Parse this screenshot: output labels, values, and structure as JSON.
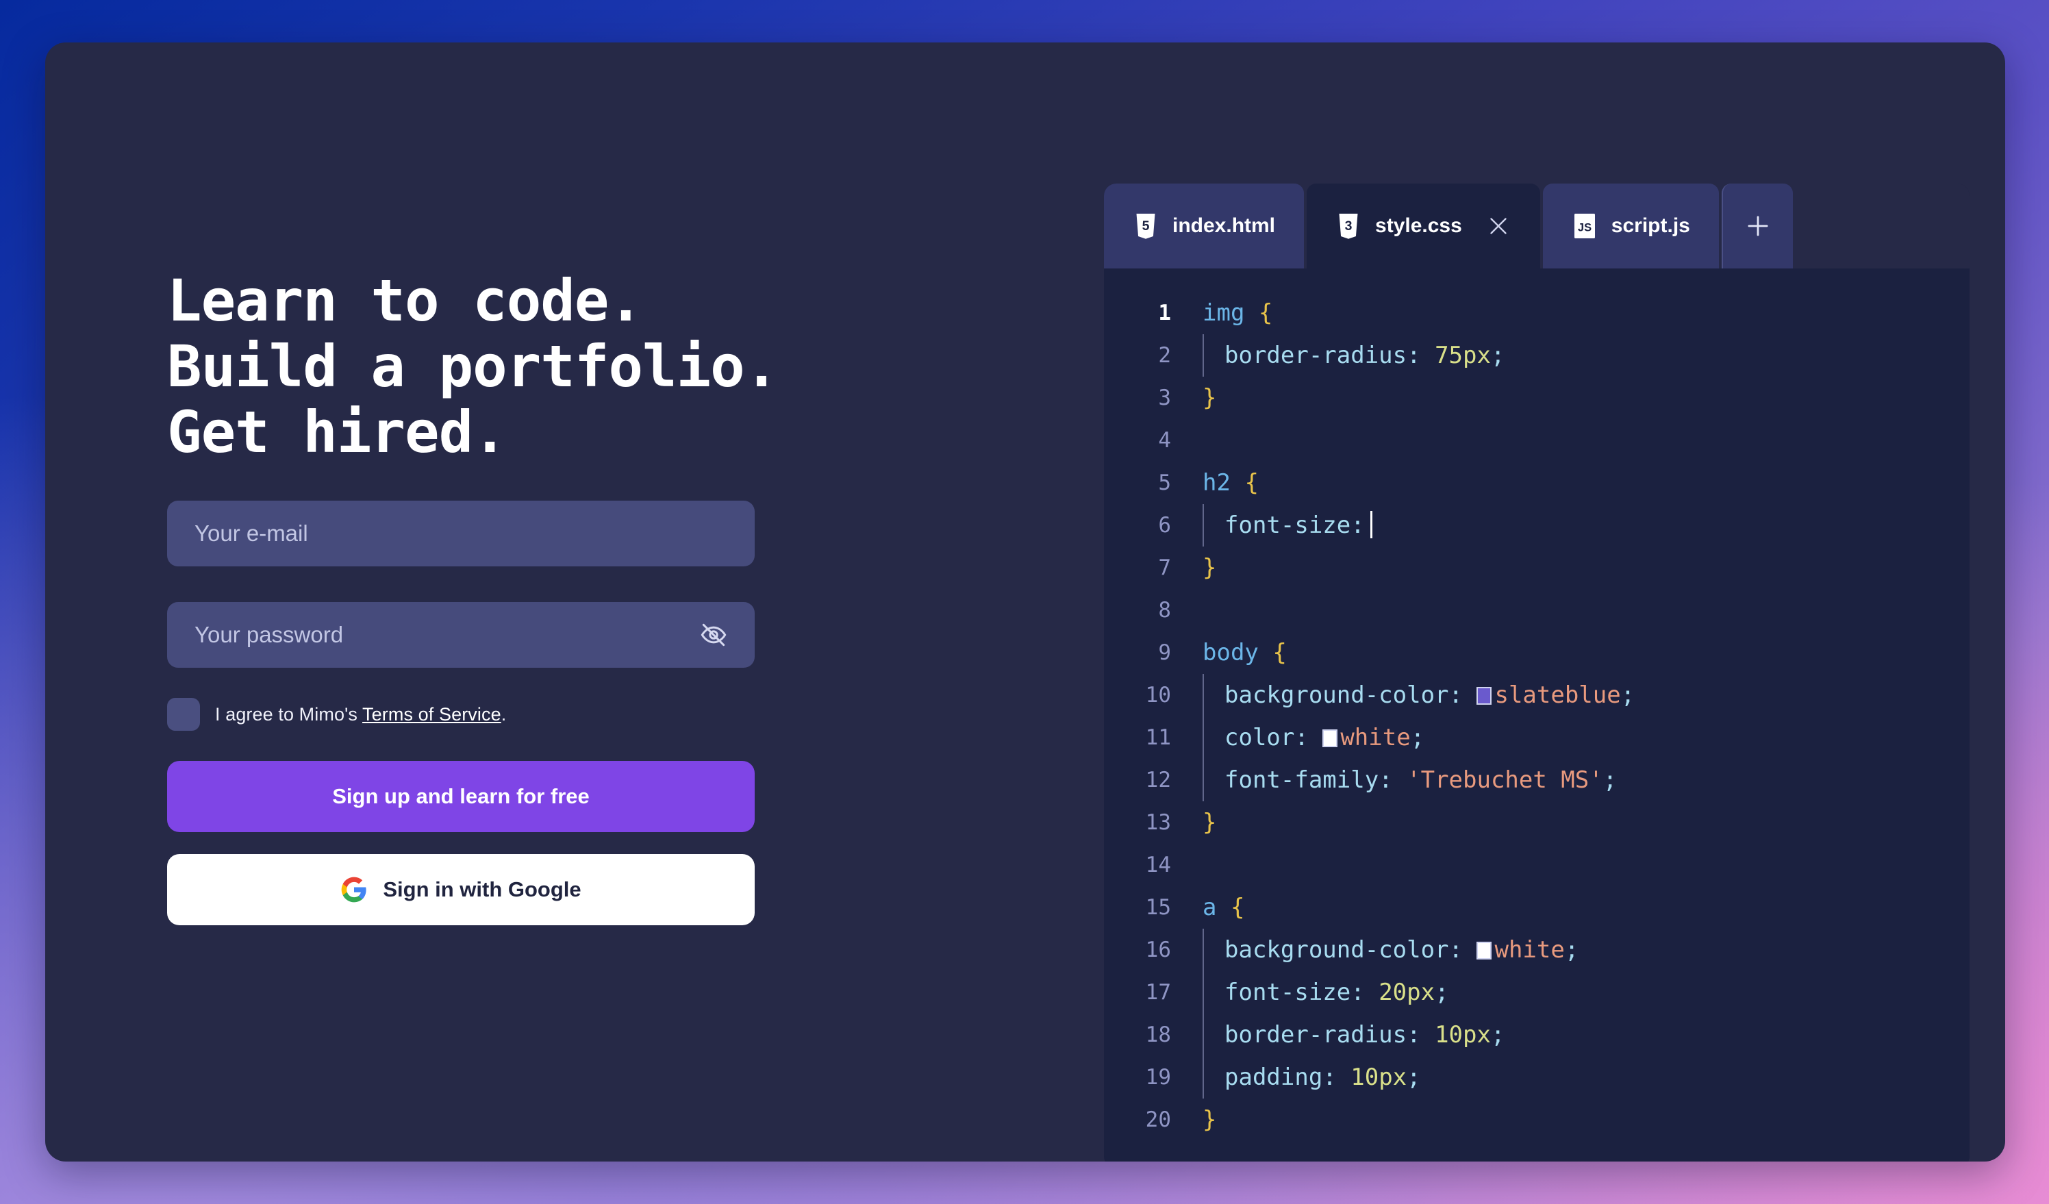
{
  "theme": {
    "card_bg": "#262947",
    "accent_purple": "#7f45e6",
    "editor_bg": "#1b2140",
    "tab_inactive_bg": "#33386a",
    "input_bg": "#464b7c",
    "gradient_top_left": "#062a9e",
    "gradient_bottom_left": "#8d7cd4",
    "gradient_bottom_right": "#e07ad0"
  },
  "hero": {
    "headline_lines": [
      "Learn to code.",
      "Build a portfolio.",
      "Get hired."
    ]
  },
  "form": {
    "email": {
      "placeholder": "Your e-mail",
      "value": ""
    },
    "password": {
      "placeholder": "Your password",
      "value": ""
    },
    "password_toggle_icon": "eye-off-icon",
    "terms": {
      "checked": false,
      "text_before": "I agree to Mimo's ",
      "link_text": "Terms of Service",
      "text_after": "."
    },
    "signup_button": "Sign up and learn for free",
    "google_button": "Sign in with Google",
    "google_icon": "google-g-icon"
  },
  "editor": {
    "tabs": [
      {
        "label": "index.html",
        "icon": "html5-icon",
        "active": false,
        "closable": false
      },
      {
        "label": "style.css",
        "icon": "css3-icon",
        "active": true,
        "closable": true
      },
      {
        "label": "script.js",
        "icon": "js-icon",
        "active": false,
        "closable": false
      }
    ],
    "add_tab_icon": "plus-icon",
    "close_icon": "close-icon",
    "active_line": 1,
    "cursor_line": 6,
    "lines": [
      {
        "n": 1,
        "indent": 0,
        "tokens": [
          {
            "t": "sel",
            "v": "img"
          },
          {
            "t": "plain",
            "v": " "
          },
          {
            "t": "brace",
            "v": "{"
          }
        ]
      },
      {
        "n": 2,
        "indent": 1,
        "tokens": [
          {
            "t": "prop",
            "v": "border-radius"
          },
          {
            "t": "punc",
            "v": ":"
          },
          {
            "t": "plain",
            "v": " "
          },
          {
            "t": "num",
            "v": "75px"
          },
          {
            "t": "punc",
            "v": ";"
          }
        ]
      },
      {
        "n": 3,
        "indent": 0,
        "tokens": [
          {
            "t": "brace",
            "v": "}"
          }
        ]
      },
      {
        "n": 4,
        "indent": 0,
        "tokens": []
      },
      {
        "n": 5,
        "indent": 0,
        "tokens": [
          {
            "t": "sel",
            "v": "h2"
          },
          {
            "t": "plain",
            "v": " "
          },
          {
            "t": "brace",
            "v": "{"
          }
        ]
      },
      {
        "n": 6,
        "indent": 1,
        "tokens": [
          {
            "t": "prop",
            "v": "font-size"
          },
          {
            "t": "punc",
            "v": ":"
          },
          {
            "t": "caret",
            "v": ""
          }
        ]
      },
      {
        "n": 7,
        "indent": 0,
        "tokens": [
          {
            "t": "brace",
            "v": "}"
          }
        ]
      },
      {
        "n": 8,
        "indent": 0,
        "tokens": []
      },
      {
        "n": 9,
        "indent": 0,
        "tokens": [
          {
            "t": "sel",
            "v": "body"
          },
          {
            "t": "plain",
            "v": " "
          },
          {
            "t": "brace",
            "v": "{"
          }
        ]
      },
      {
        "n": 10,
        "indent": 1,
        "tokens": [
          {
            "t": "prop",
            "v": "background-color"
          },
          {
            "t": "punc",
            "v": ":"
          },
          {
            "t": "plain",
            "v": " "
          },
          {
            "t": "swatch",
            "v": "#6a5acd"
          },
          {
            "t": "kw",
            "v": "slateblue"
          },
          {
            "t": "punc",
            "v": ";"
          }
        ]
      },
      {
        "n": 11,
        "indent": 1,
        "tokens": [
          {
            "t": "prop",
            "v": "color"
          },
          {
            "t": "punc",
            "v": ":"
          },
          {
            "t": "plain",
            "v": " "
          },
          {
            "t": "swatch",
            "v": "#ffffff"
          },
          {
            "t": "kw",
            "v": "white"
          },
          {
            "t": "punc",
            "v": ";"
          }
        ]
      },
      {
        "n": 12,
        "indent": 1,
        "tokens": [
          {
            "t": "prop",
            "v": "font-family"
          },
          {
            "t": "punc",
            "v": ":"
          },
          {
            "t": "plain",
            "v": " "
          },
          {
            "t": "str",
            "v": "'Trebuchet MS'"
          },
          {
            "t": "punc",
            "v": ";"
          }
        ]
      },
      {
        "n": 13,
        "indent": 0,
        "tokens": [
          {
            "t": "brace",
            "v": "}"
          }
        ]
      },
      {
        "n": 14,
        "indent": 0,
        "tokens": []
      },
      {
        "n": 15,
        "indent": 0,
        "tokens": [
          {
            "t": "sel",
            "v": "a"
          },
          {
            "t": "plain",
            "v": " "
          },
          {
            "t": "brace",
            "v": "{"
          }
        ]
      },
      {
        "n": 16,
        "indent": 1,
        "tokens": [
          {
            "t": "prop",
            "v": "background-color"
          },
          {
            "t": "punc",
            "v": ":"
          },
          {
            "t": "plain",
            "v": " "
          },
          {
            "t": "swatch",
            "v": "#ffffff"
          },
          {
            "t": "kw",
            "v": "white"
          },
          {
            "t": "punc",
            "v": ";"
          }
        ]
      },
      {
        "n": 17,
        "indent": 1,
        "tokens": [
          {
            "t": "prop",
            "v": "font-size"
          },
          {
            "t": "punc",
            "v": ":"
          },
          {
            "t": "plain",
            "v": " "
          },
          {
            "t": "num",
            "v": "20px"
          },
          {
            "t": "punc",
            "v": ";"
          }
        ]
      },
      {
        "n": 18,
        "indent": 1,
        "tokens": [
          {
            "t": "prop",
            "v": "border-radius"
          },
          {
            "t": "punc",
            "v": ":"
          },
          {
            "t": "plain",
            "v": " "
          },
          {
            "t": "num",
            "v": "10px"
          },
          {
            "t": "punc",
            "v": ";"
          }
        ]
      },
      {
        "n": 19,
        "indent": 1,
        "tokens": [
          {
            "t": "prop",
            "v": "padding"
          },
          {
            "t": "punc",
            "v": ":"
          },
          {
            "t": "plain",
            "v": " "
          },
          {
            "t": "num",
            "v": "10px"
          },
          {
            "t": "punc",
            "v": ";"
          }
        ]
      },
      {
        "n": 20,
        "indent": 0,
        "tokens": [
          {
            "t": "brace",
            "v": "}"
          }
        ]
      }
    ]
  }
}
